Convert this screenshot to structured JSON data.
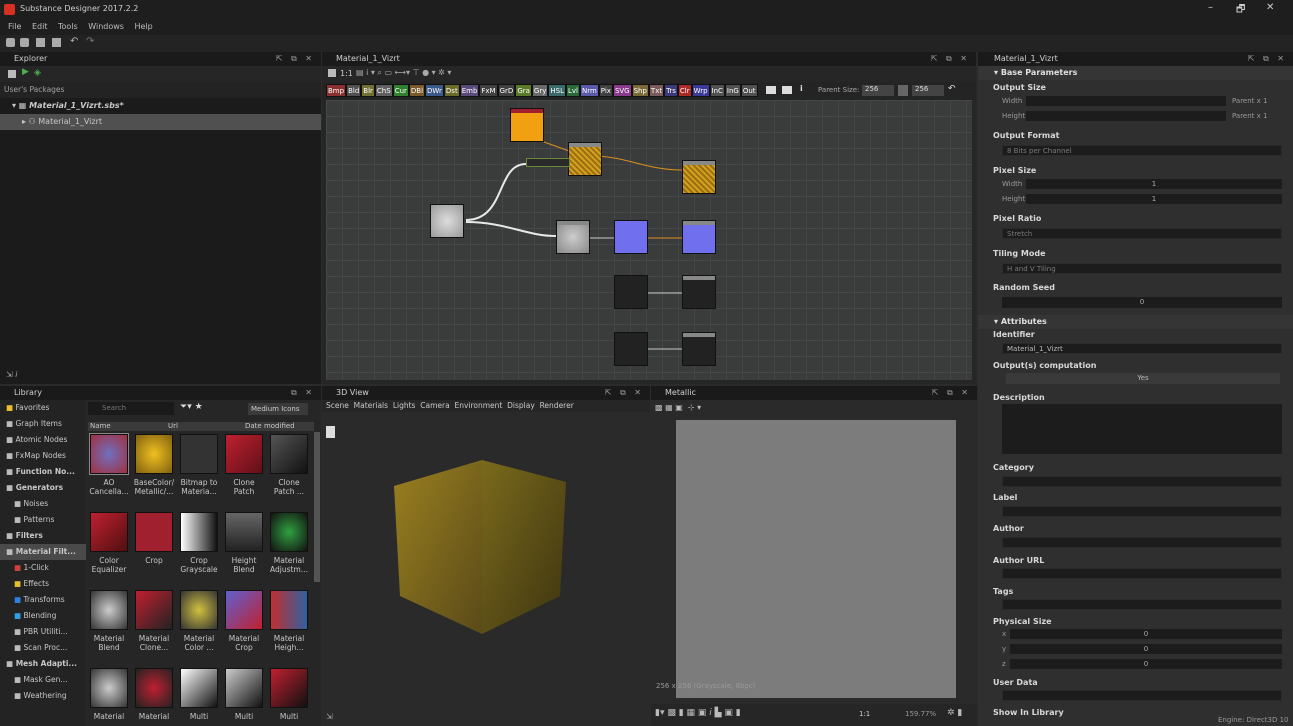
{
  "window": {
    "title": "Substance Designer 2017.2.2",
    "controls": [
      "–",
      "🗗",
      "✕"
    ]
  },
  "menu": [
    "File",
    "Edit",
    "Tools",
    "Windows",
    "Help"
  ],
  "explorer": {
    "title": "Explorer",
    "section": "User's Packages",
    "package": "Material_1_Vizrt.sbs*",
    "graph": "Material_1_Vizrt"
  },
  "graph": {
    "tab": "Material_1_Vizrt",
    "zoom": "1:1",
    "chips": [
      {
        "label": "Bmp",
        "color": "#8a3030"
      },
      {
        "label": "Bld",
        "color": "#505050"
      },
      {
        "label": "Blr",
        "color": "#707030"
      },
      {
        "label": "ChS",
        "color": "#606060"
      },
      {
        "label": "Cur",
        "color": "#308030"
      },
      {
        "label": "DBl",
        "color": "#7a5a2a"
      },
      {
        "label": "DWr",
        "color": "#3a5a8a"
      },
      {
        "label": "Dst",
        "color": "#6a6a2a"
      },
      {
        "label": "Emb",
        "color": "#5a4a7a"
      },
      {
        "label": "FxM",
        "color": "#404040"
      },
      {
        "label": "GrD",
        "color": "#404040"
      },
      {
        "label": "Gra",
        "color": "#5a7a2a"
      },
      {
        "label": "Gry",
        "color": "#6a6a6a"
      },
      {
        "label": "HSL",
        "color": "#3a6a6a"
      },
      {
        "label": "Lvl",
        "color": "#2a6a3a"
      },
      {
        "label": "Nrm",
        "color": "#5a5aaa"
      },
      {
        "label": "Pix",
        "color": "#404040"
      },
      {
        "label": "SVG",
        "color": "#8a3a8a"
      },
      {
        "label": "Shp",
        "color": "#7a6a3a"
      },
      {
        "label": "Txt",
        "color": "#7a5a5a"
      },
      {
        "label": "Trs",
        "color": "#3a3a7a"
      },
      {
        "label": "Clr",
        "color": "#aa2a2a"
      },
      {
        "label": "Wrp",
        "color": "#3a3a9a"
      },
      {
        "label": "InC",
        "color": "#505050"
      },
      {
        "label": "InG",
        "color": "#505050"
      },
      {
        "label": "Out",
        "color": "#505050"
      }
    ],
    "parent_size_label": "Parent Size:",
    "parent_size_a": "256",
    "parent_size_b": "256"
  },
  "library": {
    "title": "Library",
    "search_placeholder": "Search",
    "view_mode": "Medium Icons",
    "columns": [
      "Name",
      "Url",
      "Date modified"
    ],
    "categories": [
      {
        "label": "Favorites",
        "icon": "star-icon"
      },
      {
        "label": "Graph Items",
        "icon": "graph-icon"
      },
      {
        "label": "Atomic Nodes",
        "icon": "atomic-icon"
      },
      {
        "label": "FxMap Nodes",
        "icon": "fxmap-icon"
      },
      {
        "label": "Function No...",
        "icon": "function-icon"
      },
      {
        "label": "Generators",
        "icon": "generators-icon"
      },
      {
        "label": "Noises",
        "icon": "noise-icon"
      },
      {
        "label": "Patterns",
        "icon": "pattern-icon"
      },
      {
        "label": "Filters",
        "icon": "filters-icon"
      },
      {
        "label": "Material Filt...",
        "icon": "material-icon"
      },
      {
        "label": "1-Click",
        "icon": "oneclick-icon"
      },
      {
        "label": "Effects",
        "icon": "effects-icon"
      },
      {
        "label": "Transforms",
        "icon": "transforms-icon"
      },
      {
        "label": "Blending",
        "icon": "blending-icon"
      },
      {
        "label": "PBR Utiliti...",
        "icon": "pbr-icon"
      },
      {
        "label": "Scan Proc...",
        "icon": "scan-icon"
      },
      {
        "label": "Mesh Adapti...",
        "icon": "mesh-icon"
      },
      {
        "label": "Mask Gen...",
        "icon": "mask-icon"
      },
      {
        "label": "Weathering",
        "icon": "weathering-icon"
      }
    ],
    "items": [
      {
        "l1": "AO",
        "l2": "Cancella..."
      },
      {
        "l1": "BaseColor/",
        "l2": "Metallic/..."
      },
      {
        "l1": "Bitmap to",
        "l2": "Materia..."
      },
      {
        "l1": "Clone",
        "l2": "Patch"
      },
      {
        "l1": "Clone",
        "l2": "Patch ..."
      },
      {
        "l1": "Color",
        "l2": "Equalizer"
      },
      {
        "l1": "Crop",
        "l2": ""
      },
      {
        "l1": "Crop",
        "l2": "Grayscale"
      },
      {
        "l1": "Height",
        "l2": "Blend"
      },
      {
        "l1": "Material",
        "l2": "Adjustm..."
      },
      {
        "l1": "Material",
        "l2": "Blend"
      },
      {
        "l1": "Material",
        "l2": "Clone..."
      },
      {
        "l1": "Material",
        "l2": "Color ..."
      },
      {
        "l1": "Material",
        "l2": "Crop"
      },
      {
        "l1": "Material",
        "l2": "Heigh..."
      },
      {
        "l1": "Material",
        "l2": ""
      },
      {
        "l1": "Material",
        "l2": ""
      },
      {
        "l1": "Multi",
        "l2": ""
      },
      {
        "l1": "Multi",
        "l2": ""
      },
      {
        "l1": "Multi",
        "l2": ""
      }
    ]
  },
  "view3d": {
    "title": "3D View",
    "menu": [
      "Scene",
      "Materials",
      "Lights",
      "Camera",
      "Environment",
      "Display",
      "Renderer"
    ]
  },
  "view2d": {
    "title": "Metallic",
    "status": "256 x 256 (Grayscale, 8bpc)",
    "zoom": "159.77%",
    "ratio": "1:1"
  },
  "properties": {
    "title": "Material_1_Vizrt",
    "base_section": "Base Parameters",
    "output_size": "Output Size",
    "width": "Width",
    "height": "Height",
    "parent_x1": "Parent x 1",
    "output_format": "Output Format",
    "output_format_value": "8 Bits per Channel",
    "pixel_size": "Pixel Size",
    "pixel_value": "1",
    "pixel_ratio": "Pixel Ratio",
    "pixel_ratio_value": "Stretch",
    "tiling_mode": "Tiling Mode",
    "tiling_mode_value": "H and V Tiling",
    "random_seed": "Random Seed",
    "random_seed_value": "0",
    "attributes_section": "Attributes",
    "identifier": "Identifier",
    "identifier_value": "Material_1_Vizrt",
    "outputs_comp": "Output(s) computation",
    "outputs_comp_value": "Yes",
    "description": "Description",
    "category": "Category",
    "label": "Label",
    "author": "Author",
    "author_url": "Author URL",
    "tags": "Tags",
    "physical_size": "Physical Size",
    "phys_x": "x",
    "phys_y": "y",
    "phys_z": "z",
    "phys_val": "0",
    "user_data": "User Data",
    "show_in_library": "Show In Library",
    "engine": "Engine: Direct3D 10"
  },
  "colors": {
    "orange_node": "#f0a010",
    "blue_node": "#7070ee",
    "accent": "#c02030"
  }
}
